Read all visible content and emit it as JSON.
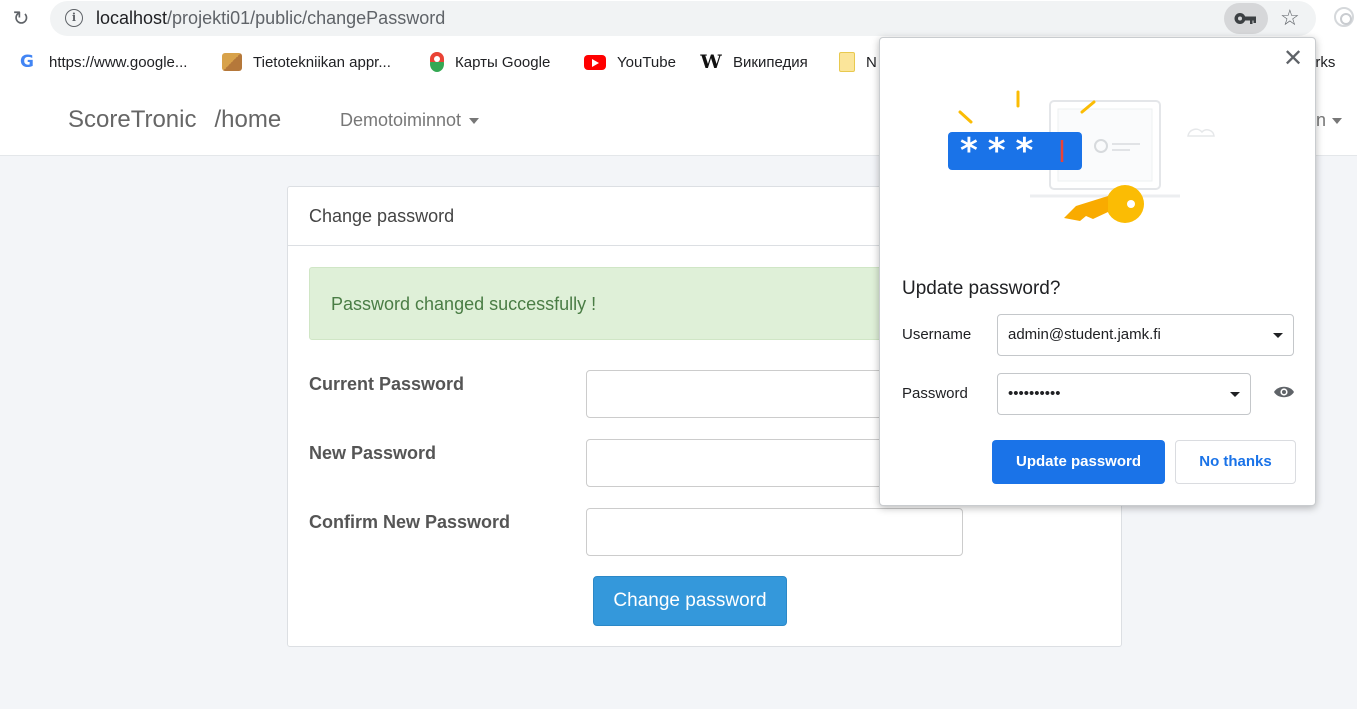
{
  "browser": {
    "url_host": "localhost",
    "url_path": "/projekti01/public/changePassword",
    "bookmarks": [
      {
        "label": "https://www.google...",
        "icon": "google-icon"
      },
      {
        "label": "Tietotekniikan appr...",
        "icon": "bookmark-favicon"
      },
      {
        "label": "Карты Google",
        "icon": "maps-icon"
      },
      {
        "label": "YouTube",
        "icon": "youtube-icon"
      },
      {
        "label": "Википедия",
        "icon": "wikipedia-icon"
      },
      {
        "label": "N",
        "icon": "folder-icon"
      },
      {
        "label": "arks",
        "icon": "none"
      }
    ]
  },
  "navbar": {
    "brand": "ScoreTronic",
    "route": "/home",
    "menu": "Demotoiminnot",
    "right_menu": "n"
  },
  "card": {
    "header": "Change password",
    "alert": "Password changed successfully !",
    "fields": [
      {
        "label": "Current Password"
      },
      {
        "label": "New Password"
      },
      {
        "label": "Confirm New Password"
      }
    ],
    "submit_label": "Change password"
  },
  "popup": {
    "title": "Update password?",
    "username_label": "Username",
    "username_value": "admin@student.jamk.fi",
    "password_label": "Password",
    "password_value": "••••••••••",
    "update_label": "Update password",
    "no_thanks_label": "No thanks",
    "illustration_text": "***"
  },
  "colors": {
    "primary_blue": "#1a73e8",
    "submit_blue": "#3498db",
    "alert_bg": "#dff0d8",
    "alert_text": "#4a7d45"
  }
}
